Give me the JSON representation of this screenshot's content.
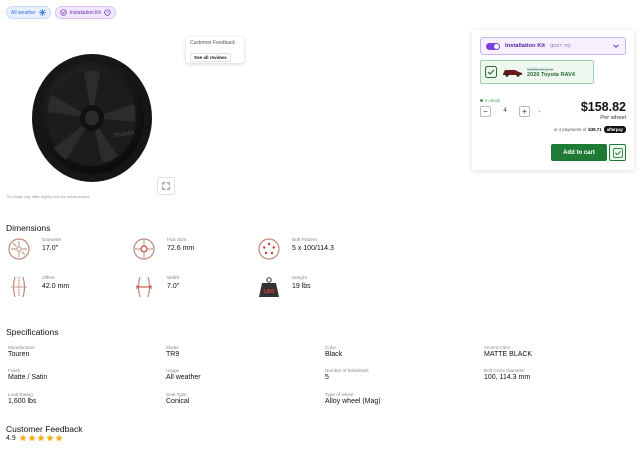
{
  "tags": [
    {
      "label": "All weather"
    },
    {
      "label": "Installation Kit"
    }
  ],
  "image_note": "The image may differ slightly from the actual product",
  "feedback_card": {
    "title": "Customer Feedback",
    "button": "See all reviews"
  },
  "purchase": {
    "kit_label": "Installation Kit",
    "kit_price": "($247.76)",
    "fit_small": "Will fit on your",
    "fit_car": "2020 Toyota RAV4",
    "stock": "In stock",
    "quantity": "4",
    "price": "$158.82",
    "per_wheel": "Per wheel",
    "pay_prefix": "or 4 payments of",
    "pay_amount": "$39.71",
    "afterpay": "afterpay",
    "add_to_cart": "Add to cart"
  },
  "dimensions": {
    "title": "Dimensions",
    "items": [
      {
        "label": "Diameter",
        "value": "17.0\"",
        "icon": "wheel-icon"
      },
      {
        "label": "Hub Size",
        "value": "72.6 mm",
        "icon": "hub-icon"
      },
      {
        "label": "Bolt Pattern",
        "value": "5 x 100/114.3",
        "icon": "bolt-pattern-icon"
      },
      {
        "label": "Offset",
        "value": "42.0 mm",
        "icon": "offset-icon"
      },
      {
        "label": "Width",
        "value": "7.0\"",
        "icon": "width-icon"
      },
      {
        "label": "Weight",
        "value": "19 lbs",
        "icon": "weight-icon",
        "badge": "LBS"
      }
    ]
  },
  "specifications": {
    "title": "Specifications",
    "items": [
      {
        "label": "Manufacturer",
        "value": "Touren"
      },
      {
        "label": "Model",
        "value": "TR9"
      },
      {
        "label": "Color",
        "value": "Black"
      },
      {
        "label": "Accent Color",
        "value": "MATTE BLACK"
      },
      {
        "label": "Finish",
        "value": "Matte / Satin"
      },
      {
        "label": "Usage",
        "value": "All weather"
      },
      {
        "label": "Number of Bolts/Nuts",
        "value": "5"
      },
      {
        "label": "Bolt Circle Diameter",
        "value": "100, 114.3 mm"
      },
      {
        "label": "Load Rating",
        "value": "1,600 lbs"
      },
      {
        "label": "Seat Type",
        "value": "Conical"
      },
      {
        "label": "Type of wheel",
        "value": "Alloy wheel (Mag)"
      }
    ]
  },
  "feedback": {
    "title": "Customer Feedback",
    "rating": "4.9",
    "stars": 5
  },
  "colors": {
    "accent": "#1e7a35",
    "kit": "#7b3ee0",
    "star": "#f2b01e"
  }
}
